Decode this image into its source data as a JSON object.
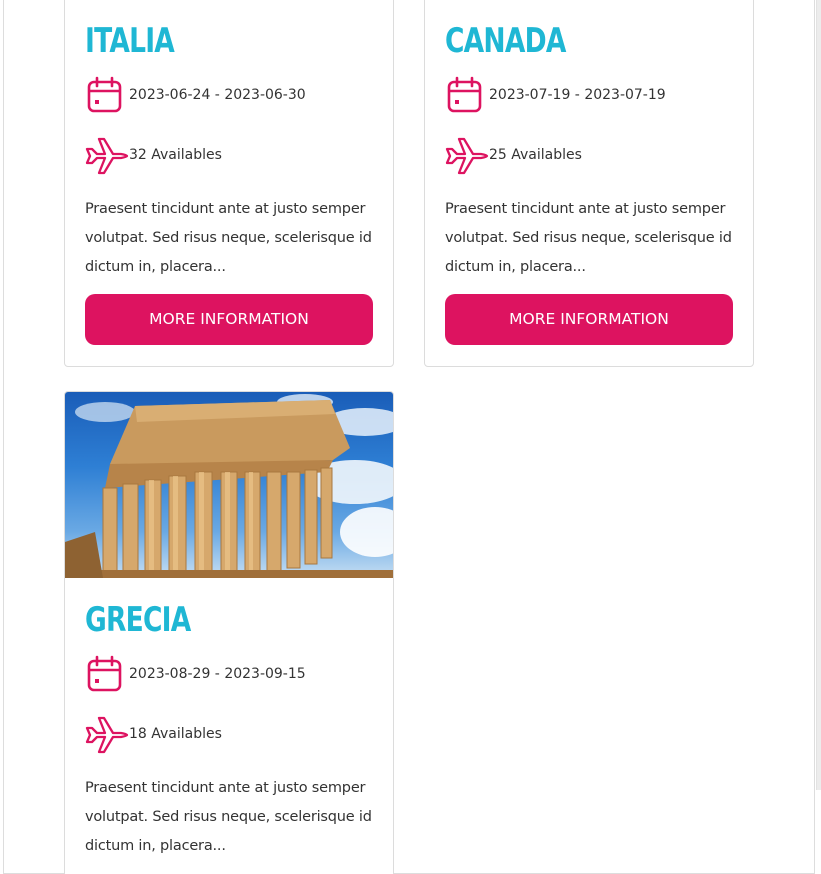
{
  "colors": {
    "accent": "#dd1360",
    "title": "#1fb7d4"
  },
  "cards": [
    {
      "title": "Italia",
      "dates": "2023-06-24 - 2023-06-30",
      "availability": "32 Availables",
      "description": "Praesent tincidunt ante at justo semper volutpat. Sed risus neque, scelerisque id dictum in, placera...",
      "button": "MORE INFORMATION",
      "icons": [
        "calendar-icon",
        "airplane-icon"
      ]
    },
    {
      "title": "Canada",
      "dates": "2023-07-19 - 2023-07-19",
      "availability": "25 Availables",
      "description": "Praesent tincidunt ante at justo semper volutpat. Sed risus neque, scelerisque id dictum in, placera...",
      "button": "MORE INFORMATION",
      "icons": [
        "calendar-icon",
        "airplane-icon"
      ]
    },
    {
      "title": "Grecia",
      "image": "parthenon-photo",
      "dates": "2023-08-29 - 2023-09-15",
      "availability": "18 Availables",
      "description": "Praesent tincidunt ante at justo semper volutpat. Sed risus neque, scelerisque id dictum in, placera...",
      "icons": [
        "calendar-icon",
        "airplane-icon"
      ]
    }
  ]
}
